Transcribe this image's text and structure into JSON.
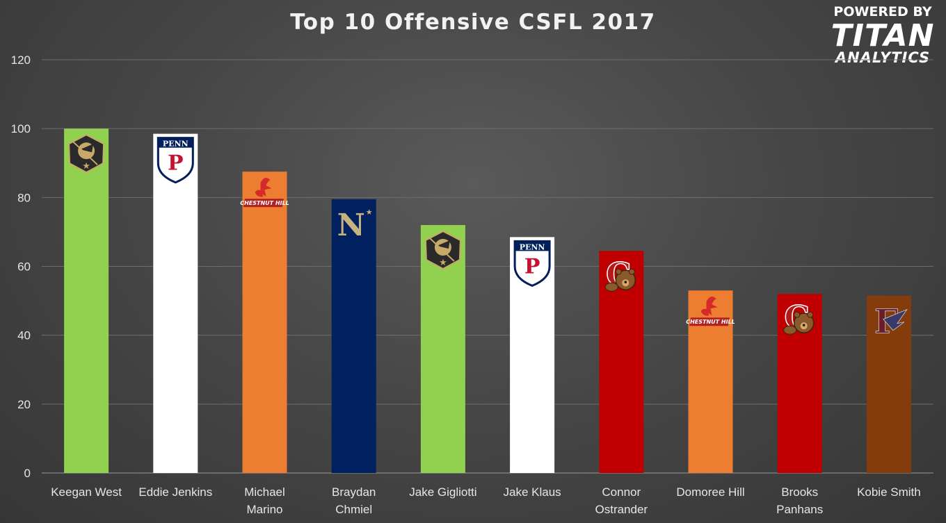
{
  "chart_data": {
    "type": "bar",
    "title": "Top 10 Offensive CSFL 2017",
    "xlabel": "",
    "ylabel": "",
    "ylim": [
      0,
      120
    ],
    "yticks": [
      0,
      20,
      40,
      60,
      80,
      100,
      120
    ],
    "grid": true,
    "categories": [
      [
        "Keegan West"
      ],
      [
        "Eddie Jenkins"
      ],
      [
        "Michael",
        "Marino"
      ],
      [
        "Braydan",
        "Chmiel"
      ],
      [
        "Jake Gigliotti"
      ],
      [
        "Jake Klaus"
      ],
      [
        "Connor",
        "Ostrander"
      ],
      [
        "Domoree Hill"
      ],
      [
        "Brooks",
        "Panhans"
      ],
      [
        "Kobie Smith"
      ]
    ],
    "values": [
      100,
      98.5,
      87.5,
      79.5,
      72,
      68.5,
      64.5,
      53,
      52,
      51.5
    ],
    "bar_colors": [
      "#92d050",
      "#ffffff",
      "#ed7d31",
      "#002060",
      "#92d050",
      "#ffffff",
      "#c00000",
      "#ed7d31",
      "#c00000",
      "#843c0c"
    ],
    "team_logos": [
      "army-logo",
      "penn-logo",
      "chestnut-hill-logo",
      "navy-logo",
      "army-logo",
      "penn-logo",
      "cornell-logo",
      "chestnut-hill-logo",
      "cornell-logo",
      "frostburg-logo"
    ]
  },
  "logo_text": {
    "penn": "PENN",
    "penn_letter": "P",
    "navy": "N",
    "navy_star": "★",
    "army_star": "★",
    "chestnut_hill": "CHESTNUT HILL",
    "cornell": "C",
    "frostburg": "F"
  },
  "brand": {
    "powered_by": "POWERED BY",
    "name": "TITAN",
    "sub": "ANALYTICS"
  }
}
